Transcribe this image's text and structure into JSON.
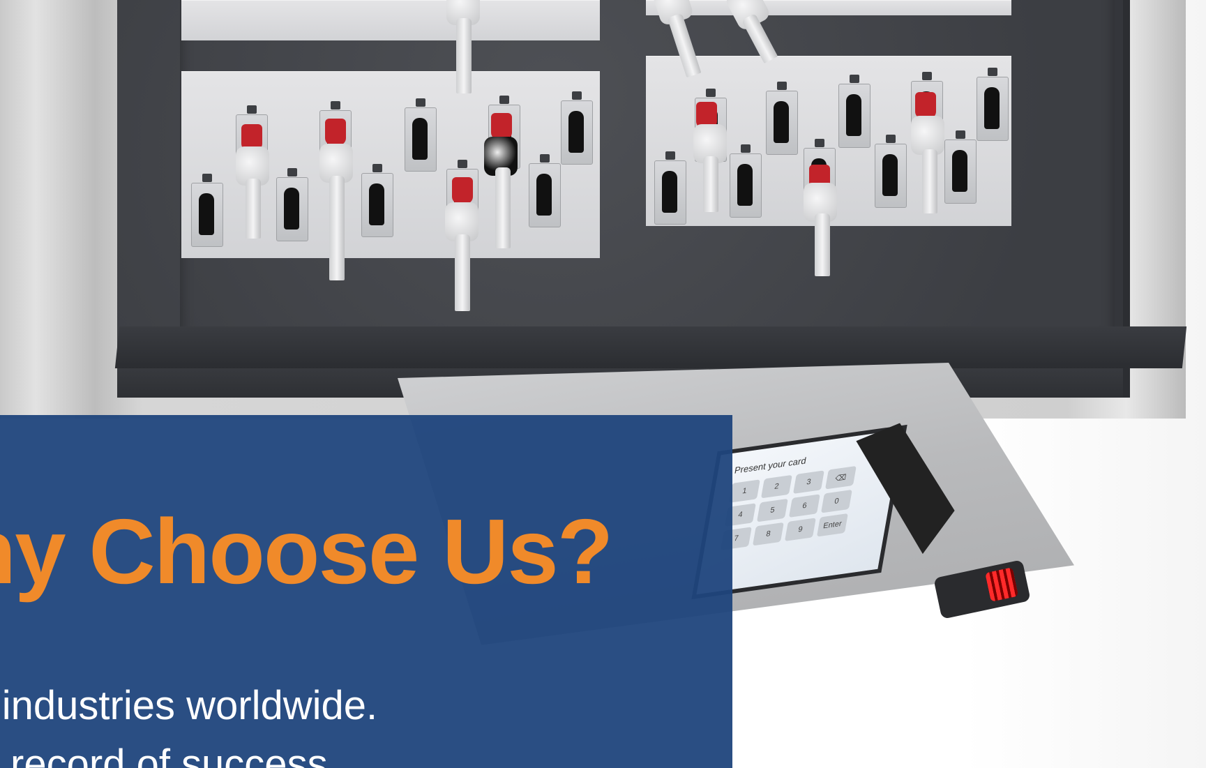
{
  "hero": {
    "title": "Why Choose Us?",
    "line1": "Serving industries worldwide.",
    "line2": "A proven record of success."
  },
  "terminal": {
    "screen_text": "Present your card",
    "keypad": [
      "1",
      "2",
      "3",
      "⌫",
      "4",
      "5",
      "6",
      "0",
      "7",
      "8",
      "9",
      "Enter"
    ]
  },
  "colors": {
    "overlay_blue": "#1f447c",
    "title_orange": "#f08a2a",
    "indicator_red": "#ff2a2a"
  }
}
